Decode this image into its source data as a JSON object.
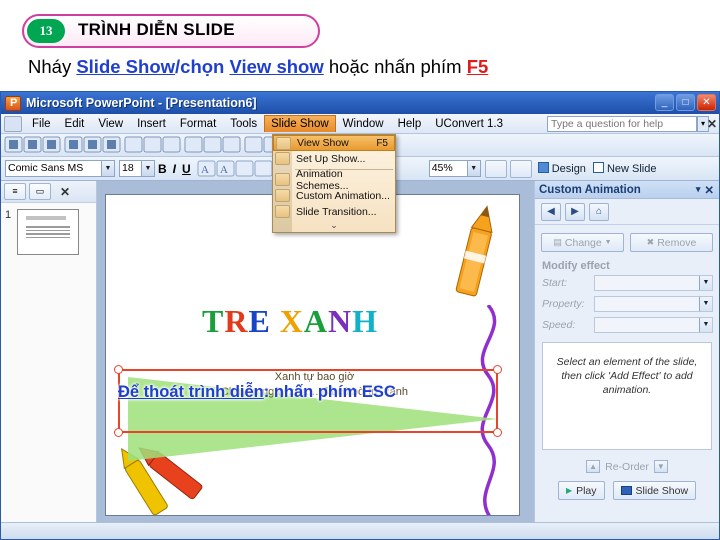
{
  "header": {
    "badge_number": "13",
    "badge_title": "TRÌNH DIỄN SLIDE",
    "line_pre": "Nháy ",
    "line_link1": "Slide Show",
    "line_mid1": "/",
    "line_bold1": "chọn ",
    "line_link2": "View show",
    "line_mid2": " hoặc nhấn phím ",
    "line_key": "F5"
  },
  "window": {
    "title": "Microsoft PowerPoint - [Presentation6]",
    "minimize": "_",
    "maximize": "□",
    "close": "✕",
    "doc_close": "✕"
  },
  "menubar": {
    "items": [
      "File",
      "Edit",
      "View",
      "Insert",
      "Format",
      "Tools",
      "Slide Show",
      "Window",
      "Help",
      "UConvert 1.3"
    ],
    "active_index": 6,
    "ask_placeholder": "Type a question for help",
    "ask_arrow": "▾"
  },
  "dropdown": {
    "items": [
      {
        "label": "View Show",
        "shortcut": "F5",
        "selected": true
      },
      {
        "label": "Set Up Show...",
        "shortcut": "",
        "selected": false
      },
      {
        "label": "Animation Schemes...",
        "shortcut": "",
        "selected": false
      },
      {
        "label": "Custom Animation...",
        "shortcut": "",
        "selected": false
      },
      {
        "label": "Slide Transition...",
        "shortcut": "",
        "selected": false
      }
    ],
    "expand_chevron": "⌄"
  },
  "formatting_toolbar": {
    "font_name": "Comic Sans MS",
    "font_size": "18",
    "bold": "B",
    "italic": "I",
    "underline": "U",
    "zoom": "45%",
    "zoom_arrow": "▾",
    "design_label": "Design",
    "new_slide_label": "New Slide"
  },
  "outline_pane": {
    "tab_outline": "≡",
    "tab_slides": "▭",
    "close": "✕",
    "slide_number": "1"
  },
  "slide": {
    "title_letters": [
      "T",
      "R",
      "E",
      " ",
      "X",
      "A",
      "N",
      "H"
    ],
    "poem_line1": "Xanh tự bao giờ",
    "poem_line2": "Chuyện ngày xưa… đã có bờ tre xanh"
  },
  "callout": {
    "text_underline": "Để thoát trình diễn",
    "text_rest": ": nhấn phím ESC"
  },
  "task_pane": {
    "title": "Custom Animation",
    "title_arrow": "▾",
    "title_close": "✕",
    "nav_back": "◀",
    "nav_forward": "▶",
    "nav_home": "⌂",
    "change_label": "Change",
    "remove_label": "Remove",
    "section_label": "Modify effect",
    "fields": [
      {
        "label": "Start:",
        "value": ""
      },
      {
        "label": "Property:",
        "value": ""
      },
      {
        "label": "Speed:",
        "value": ""
      }
    ],
    "hint": "Select an element of the slide, then click 'Add Effect' to add animation.",
    "reorder_up": "▲",
    "reorder_label": "Re-Order",
    "reorder_down": "▼",
    "play_label": "Play",
    "slideshow_label": "Slide Show"
  },
  "colors": {
    "accent_blue": "#1f3fcf",
    "accent_red": "#e01b1b",
    "badge_green": "#00a651",
    "badge_pink": "#cf3fa0",
    "menu_highlight": "#e8892a"
  }
}
